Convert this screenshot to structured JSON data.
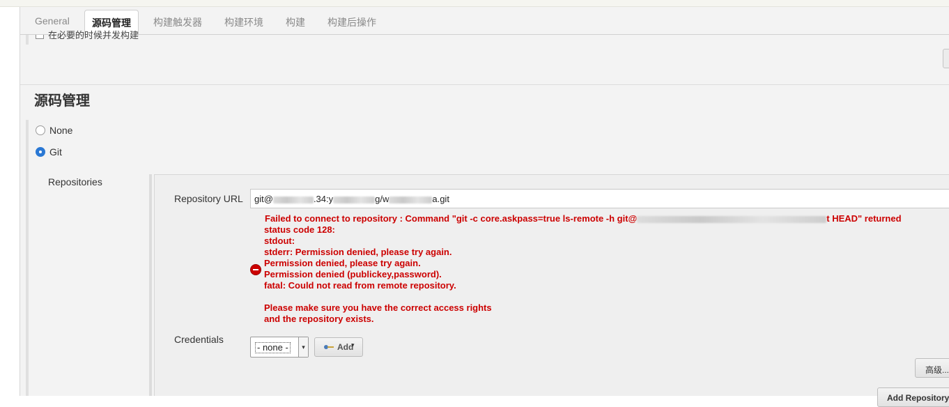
{
  "tabs": [
    {
      "label": "General"
    },
    {
      "label": "源码管理"
    },
    {
      "label": "构建触发器"
    },
    {
      "label": "构建环境"
    },
    {
      "label": "构建"
    },
    {
      "label": "构建后操作"
    }
  ],
  "prev_section": {
    "checkbox_label": "在必要的时候并发构建"
  },
  "scm": {
    "title": "源码管理",
    "options": [
      {
        "label": "None",
        "checked": false
      },
      {
        "label": "Git",
        "checked": true
      }
    ],
    "repositories_label": "Repositories",
    "repository_url": {
      "label": "Repository URL",
      "value_prefix": "git@",
      "value_mid1": ".34:y",
      "value_mid2": "g/w",
      "value_suffix": "a.git"
    },
    "error": {
      "line1_start": "Failed to connect to repository : Command \"git -c core.askpass=true ls-remote -h git@",
      "line1_end": "t HEAD\" returned",
      "lines": [
        "status code 128:",
        "stdout:",
        "stderr: Permission denied, please try again.",
        "Permission denied, please try again.",
        "Permission denied (publickey,password).",
        "fatal: Could not read from remote repository."
      ],
      "lines2": [
        "Please make sure you have the correct access rights",
        "and the repository exists."
      ],
      "icon": "error-circle-icon",
      "color": "#cc0000"
    },
    "credentials": {
      "label": "Credentials",
      "selected": "- none -",
      "add_label": "Add"
    },
    "advanced_label": "高级...",
    "add_repository_label": "Add Repository"
  }
}
